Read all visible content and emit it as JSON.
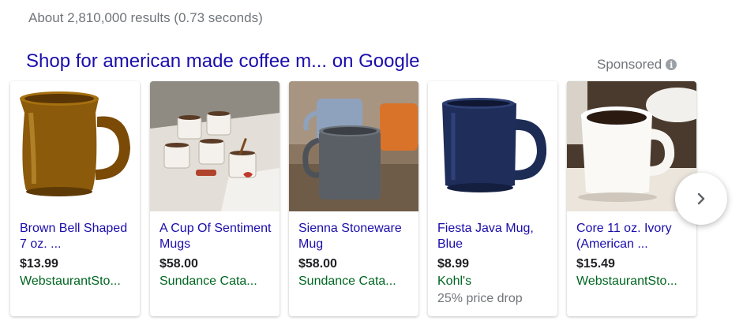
{
  "stats": "About 2,810,000 results (0.73 seconds)",
  "shopping": {
    "title": "Shop for american made coffee m... on Google",
    "sponsored": "Sponsored",
    "info_icon": "info-icon",
    "next_icon": "chevron-right-icon",
    "products": [
      {
        "name": "Brown Bell Shaped 7 oz. ...",
        "price": "$13.99",
        "seller": "WebstaurantSto...",
        "note": "",
        "image": "brown-mug-image"
      },
      {
        "name": "A Cup Of Sentiment Mugs",
        "price": "$58.00",
        "seller": "Sundance Cata...",
        "note": "",
        "image": "sentiment-mugs-image"
      },
      {
        "name": "Sienna Stoneware Mug",
        "price": "$58.00",
        "seller": "Sundance Cata...",
        "note": "",
        "image": "stoneware-mugs-image"
      },
      {
        "name": "Fiesta Java Mug, Blue",
        "price": "$8.99",
        "seller": "Kohl's",
        "note": "25% price drop",
        "image": "blue-mug-image"
      },
      {
        "name": "Core 11 oz. Ivory (American ...",
        "price": "$15.49",
        "seller": "WebstaurantSto...",
        "note": "",
        "image": "ivory-mug-image"
      }
    ]
  },
  "colors": {
    "link": "#1a0dab",
    "seller": "#006621",
    "muted": "#70757a"
  }
}
